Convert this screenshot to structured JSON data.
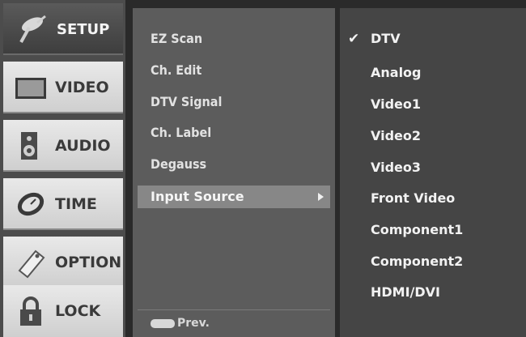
{
  "tabs": [
    {
      "label": "SETUP",
      "icon": "satellite-dish-icon",
      "active": true
    },
    {
      "label": "VIDEO",
      "icon": "tv-screen-icon",
      "active": false
    },
    {
      "label": "AUDIO",
      "icon": "speaker-icon",
      "active": false
    },
    {
      "label": "TIME",
      "icon": "clock-icon",
      "active": false
    },
    {
      "label": "OPTION",
      "icon": "tag-icon",
      "active": false
    },
    {
      "label": "LOCK",
      "icon": "padlock-icon",
      "active": false
    }
  ],
  "setup_menu": {
    "items": [
      "EZ Scan",
      "Ch. Edit",
      "DTV Signal",
      "Ch. Label",
      "Degauss",
      "Input Source"
    ],
    "selected": "Input Source",
    "footer_button_icon": "menu-button-icon",
    "footer_label": "Prev."
  },
  "input_source": {
    "options": [
      "DTV",
      "Analog",
      "Video1",
      "Video2",
      "Video3",
      "Front Video",
      "Component1",
      "Component2",
      "HDMI/DVI"
    ],
    "checked": "DTV"
  },
  "colors": {
    "active_tab": "#4a4a4a",
    "inactive_tab": "#dcdcdc",
    "middle_panel": "#5c5c5c",
    "highlight": "#878787",
    "right_panel": "#454545"
  }
}
